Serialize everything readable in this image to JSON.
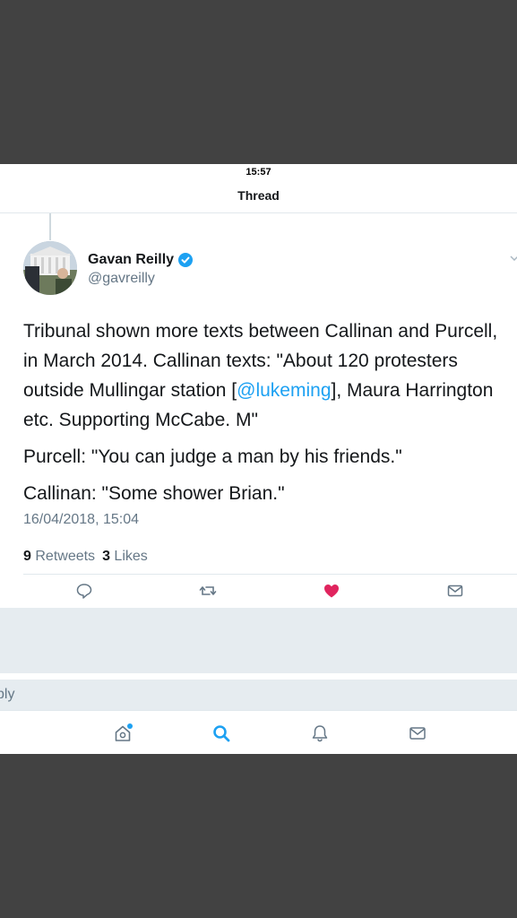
{
  "status_bar": {
    "time": "15:57"
  },
  "nav": {
    "title": "Thread"
  },
  "tweet": {
    "author_name": "Gavan Reilly",
    "author_handle": "@gavreilly",
    "verified": true,
    "text_p1_before": "Tribunal shown more texts between Callinan and Purcell, in March 2014. Callinan texts: \"About 120 protesters outside Mullingar station [",
    "mention": "@lukeming",
    "text_p1_after": "], Maura Harrington etc. Supporting McCabe. M\"",
    "text_p2": "Purcell: \"You can judge a man by his friends.\"",
    "text_p3": "Callinan: \"Some shower Brian.\"",
    "timestamp": "16/04/2018, 15:04",
    "retweets_count": "9",
    "retweets_label": "Retweets",
    "likes_count": "3",
    "likes_label": "Likes",
    "liked": true
  },
  "reply_bar": {
    "placeholder_fragment": "ply"
  },
  "colors": {
    "accent": "#1da1f2",
    "like": "#e0245e",
    "text": "#14171a",
    "muted": "#657786"
  },
  "icons": {
    "actions": [
      "reply-icon",
      "retweet-icon",
      "heart-icon",
      "message-icon"
    ],
    "tabs": [
      "home-icon",
      "search-icon",
      "bell-icon",
      "envelope-icon"
    ]
  }
}
